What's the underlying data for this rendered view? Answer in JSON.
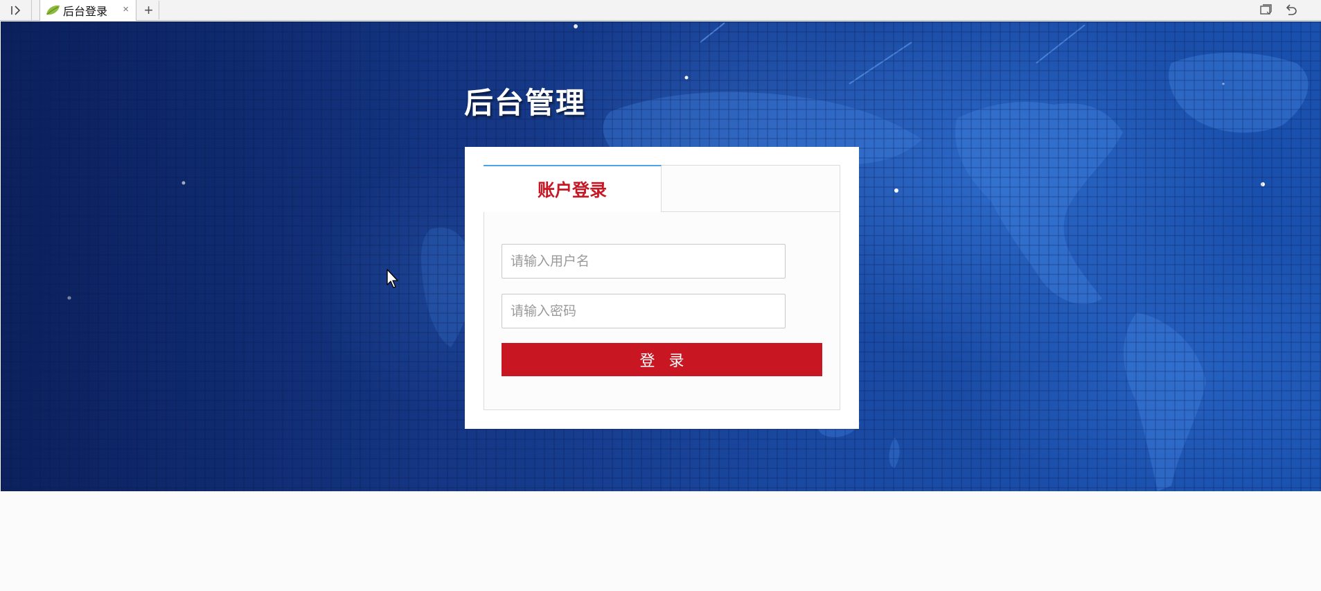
{
  "browser": {
    "tab_title": "后台登录",
    "close_glyph": "×",
    "new_tab_glyph": "+",
    "icons": [
      "sidebar-toggle-icon",
      "leaf-favicon-icon",
      "close-icon",
      "plus-icon",
      "tab-list-icon",
      "undo-icon"
    ]
  },
  "page": {
    "title": "后台管理"
  },
  "login": {
    "tab_label": "账户登录",
    "username_placeholder": "请输入用户名",
    "password_placeholder": "请输入密码",
    "submit_label": "登录"
  },
  "colors": {
    "accent_red": "#c81623",
    "tab_indicator": "#4aa3e8",
    "background_blue": "#163a8c"
  }
}
